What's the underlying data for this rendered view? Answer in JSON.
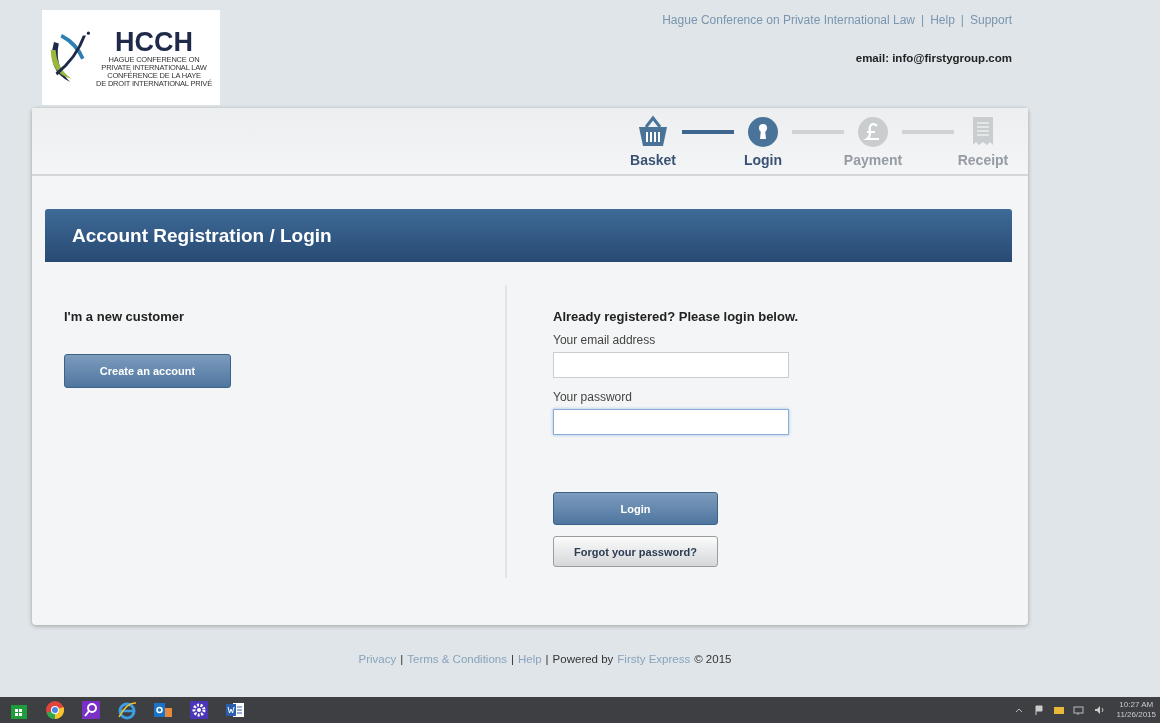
{
  "logo": {
    "title": "HCCH",
    "lines": [
      "HAGUE CONFERENCE ON",
      "PRIVATE INTERNATIONAL LAW",
      "CONFÉRENCE DE LA HAYE",
      "DE DROIT INTERNATIONAL PRIVÉ"
    ]
  },
  "top_links": {
    "separator": "|",
    "items": [
      "Hague Conference on Private International Law",
      "Help",
      "Support"
    ]
  },
  "contact_email": "email: info@firstygroup.com",
  "steps": [
    {
      "label": "Basket",
      "kind": "basket",
      "active": true
    },
    {
      "label": "Login",
      "kind": "lock",
      "active": true
    },
    {
      "label": "Payment",
      "kind": "pound",
      "active": false
    },
    {
      "label": "Receipt",
      "kind": "receipt",
      "active": false
    }
  ],
  "heading": "Account Registration / Login",
  "new_customer": {
    "title": "I'm a new customer",
    "button": "Create an account"
  },
  "login": {
    "title": "Already registered? Please login below.",
    "fields": [
      {
        "label": "Your email address",
        "focused": false
      },
      {
        "label": "Your password",
        "focused": true
      }
    ],
    "buttons": [
      {
        "label": "Login",
        "kind": "primary"
      },
      {
        "label": "Forgot your password?",
        "kind": "secondary"
      }
    ]
  },
  "footer": [
    {
      "text": "Privacy",
      "kind": "link"
    },
    {
      "text": "|",
      "kind": "text"
    },
    {
      "text": "Terms & Conditions",
      "kind": "link"
    },
    {
      "text": "|",
      "kind": "text"
    },
    {
      "text": "Help",
      "kind": "link"
    },
    {
      "text": "|",
      "kind": "text"
    },
    {
      "text": "Powered by",
      "kind": "text"
    },
    {
      "text": "Firsty Express",
      "kind": "link"
    },
    {
      "text": "© 2015",
      "kind": "text"
    }
  ],
  "taskbar": {
    "apps": [
      {
        "kind": "store"
      },
      {
        "kind": "chrome"
      },
      {
        "kind": "search"
      },
      {
        "kind": "ie"
      },
      {
        "kind": "outlook"
      },
      {
        "kind": "settings"
      },
      {
        "kind": "word"
      }
    ],
    "clock": {
      "time": "10:27 AM",
      "date": "11/26/2015"
    }
  }
}
